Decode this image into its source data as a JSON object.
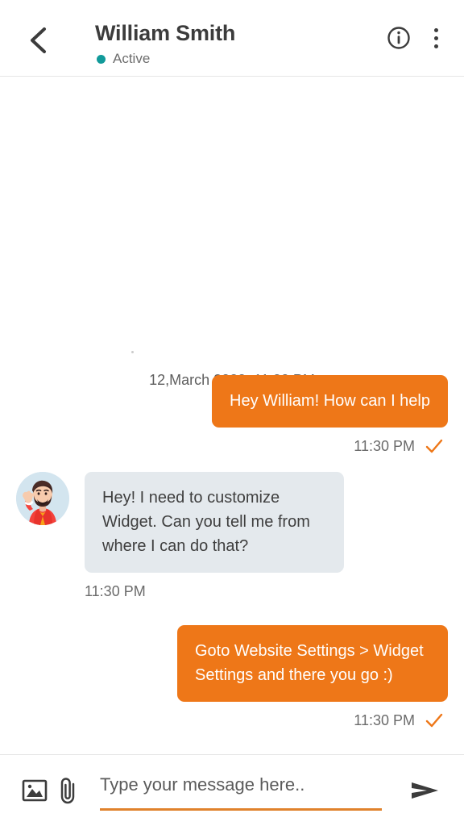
{
  "header": {
    "back_icon": "chevron-left-icon",
    "contact_name": "William Smith",
    "presence_label": "Active",
    "presence_color": "#119a9a",
    "info_icon": "info-circle-icon",
    "menu_icon": "kebab-menu-icon"
  },
  "chat": {
    "date_divider": "12,March 2020, 11:30 PM",
    "accent_color": "#ee7718",
    "incoming_bubble_color": "#e4e9ed",
    "messages": [
      {
        "id": "msg-1",
        "direction": "outgoing",
        "text": "Hey William! How can I help",
        "time": "11:30 PM",
        "status_icon": "check-icon",
        "has_avatar": false
      },
      {
        "id": "msg-2",
        "direction": "incoming",
        "text": "Hey! I need to customize Widget. Can you tell me from where I can do that?",
        "time": "11:30 PM",
        "status_icon": "",
        "has_avatar": true,
        "avatar_name": "user-avatar-illustration"
      },
      {
        "id": "msg-3",
        "direction": "outgoing",
        "text": "Goto Website Settings > Widget Settings and there you go :)",
        "time": "11:30 PM",
        "status_icon": "check-icon",
        "has_avatar": false
      }
    ]
  },
  "composer": {
    "image_icon": "image-icon",
    "attach_icon": "paperclip-icon",
    "input_value": "",
    "input_placeholder": "Type your message here..",
    "send_icon": "send-icon",
    "underline_color": "#e0822c"
  }
}
